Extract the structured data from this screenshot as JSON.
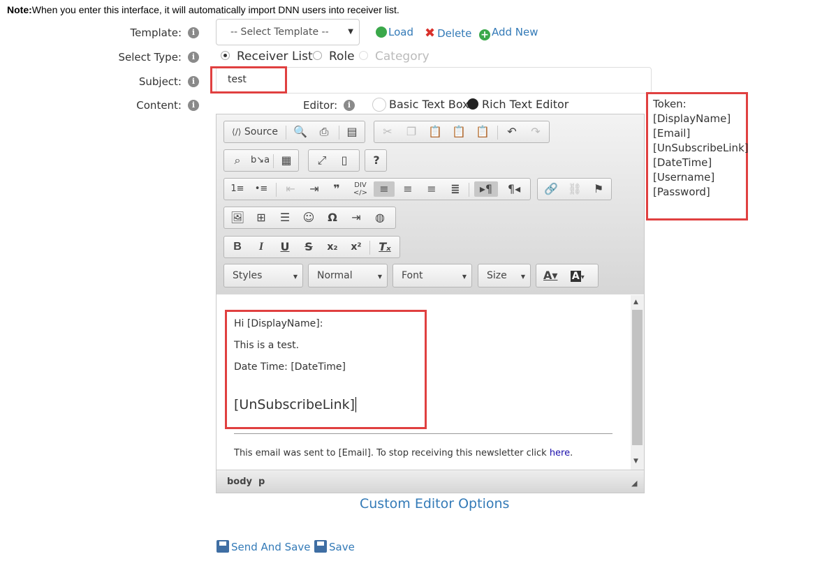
{
  "note": {
    "bold": "Note:",
    "text": "When you enter this interface, it will automatically import DNN users into receiver list."
  },
  "labels": {
    "template": "Template:",
    "select_type": "Select Type:",
    "subject": "Subject:",
    "content": "Content:",
    "editor": "Editor:"
  },
  "template": {
    "selected": "-- Select Template --",
    "load": "Load",
    "delete": "Delete",
    "add_new": "Add New"
  },
  "select_type": {
    "options": [
      {
        "label": "Receiver List",
        "checked": true,
        "disabled": false
      },
      {
        "label": "Role",
        "checked": false,
        "disabled": false
      },
      {
        "label": "Category",
        "checked": false,
        "disabled": true
      }
    ]
  },
  "subject": {
    "value": "test"
  },
  "editor_mode": {
    "basic": "Basic Text Box",
    "rich": "Rich Text Editor",
    "selected": "rich"
  },
  "toolbar": {
    "source_label": "Source",
    "styles": "Styles",
    "format": "Normal",
    "font": "Font",
    "size": "Size"
  },
  "content": {
    "line1": "Hi [DisplayName]:",
    "line2": "This is a test.",
    "line3": "Date Time: [DateTime]",
    "line4": "[UnSubscribeLink]",
    "footer_prefix": "This email was sent to [Email]. To stop receiving this newsletter click ",
    "footer_link": "here",
    "footer_suffix": "."
  },
  "statusbar": {
    "path1": "body",
    "path2": "p"
  },
  "custom_options": "Custom Editor Options",
  "tokens": {
    "title": "Token:",
    "items": [
      "[DisplayName]",
      "[Email]",
      "[UnSubscribeLink]",
      "[DateTime]",
      "[Username]",
      "[Password]"
    ]
  },
  "actions": {
    "send_and_save": "Send And Save",
    "save": "Save"
  },
  "colors": {
    "accent": "#337ab7",
    "highlight_red": "#e04040",
    "load_green": "#3aa84a",
    "delete_red": "#d9302a"
  }
}
